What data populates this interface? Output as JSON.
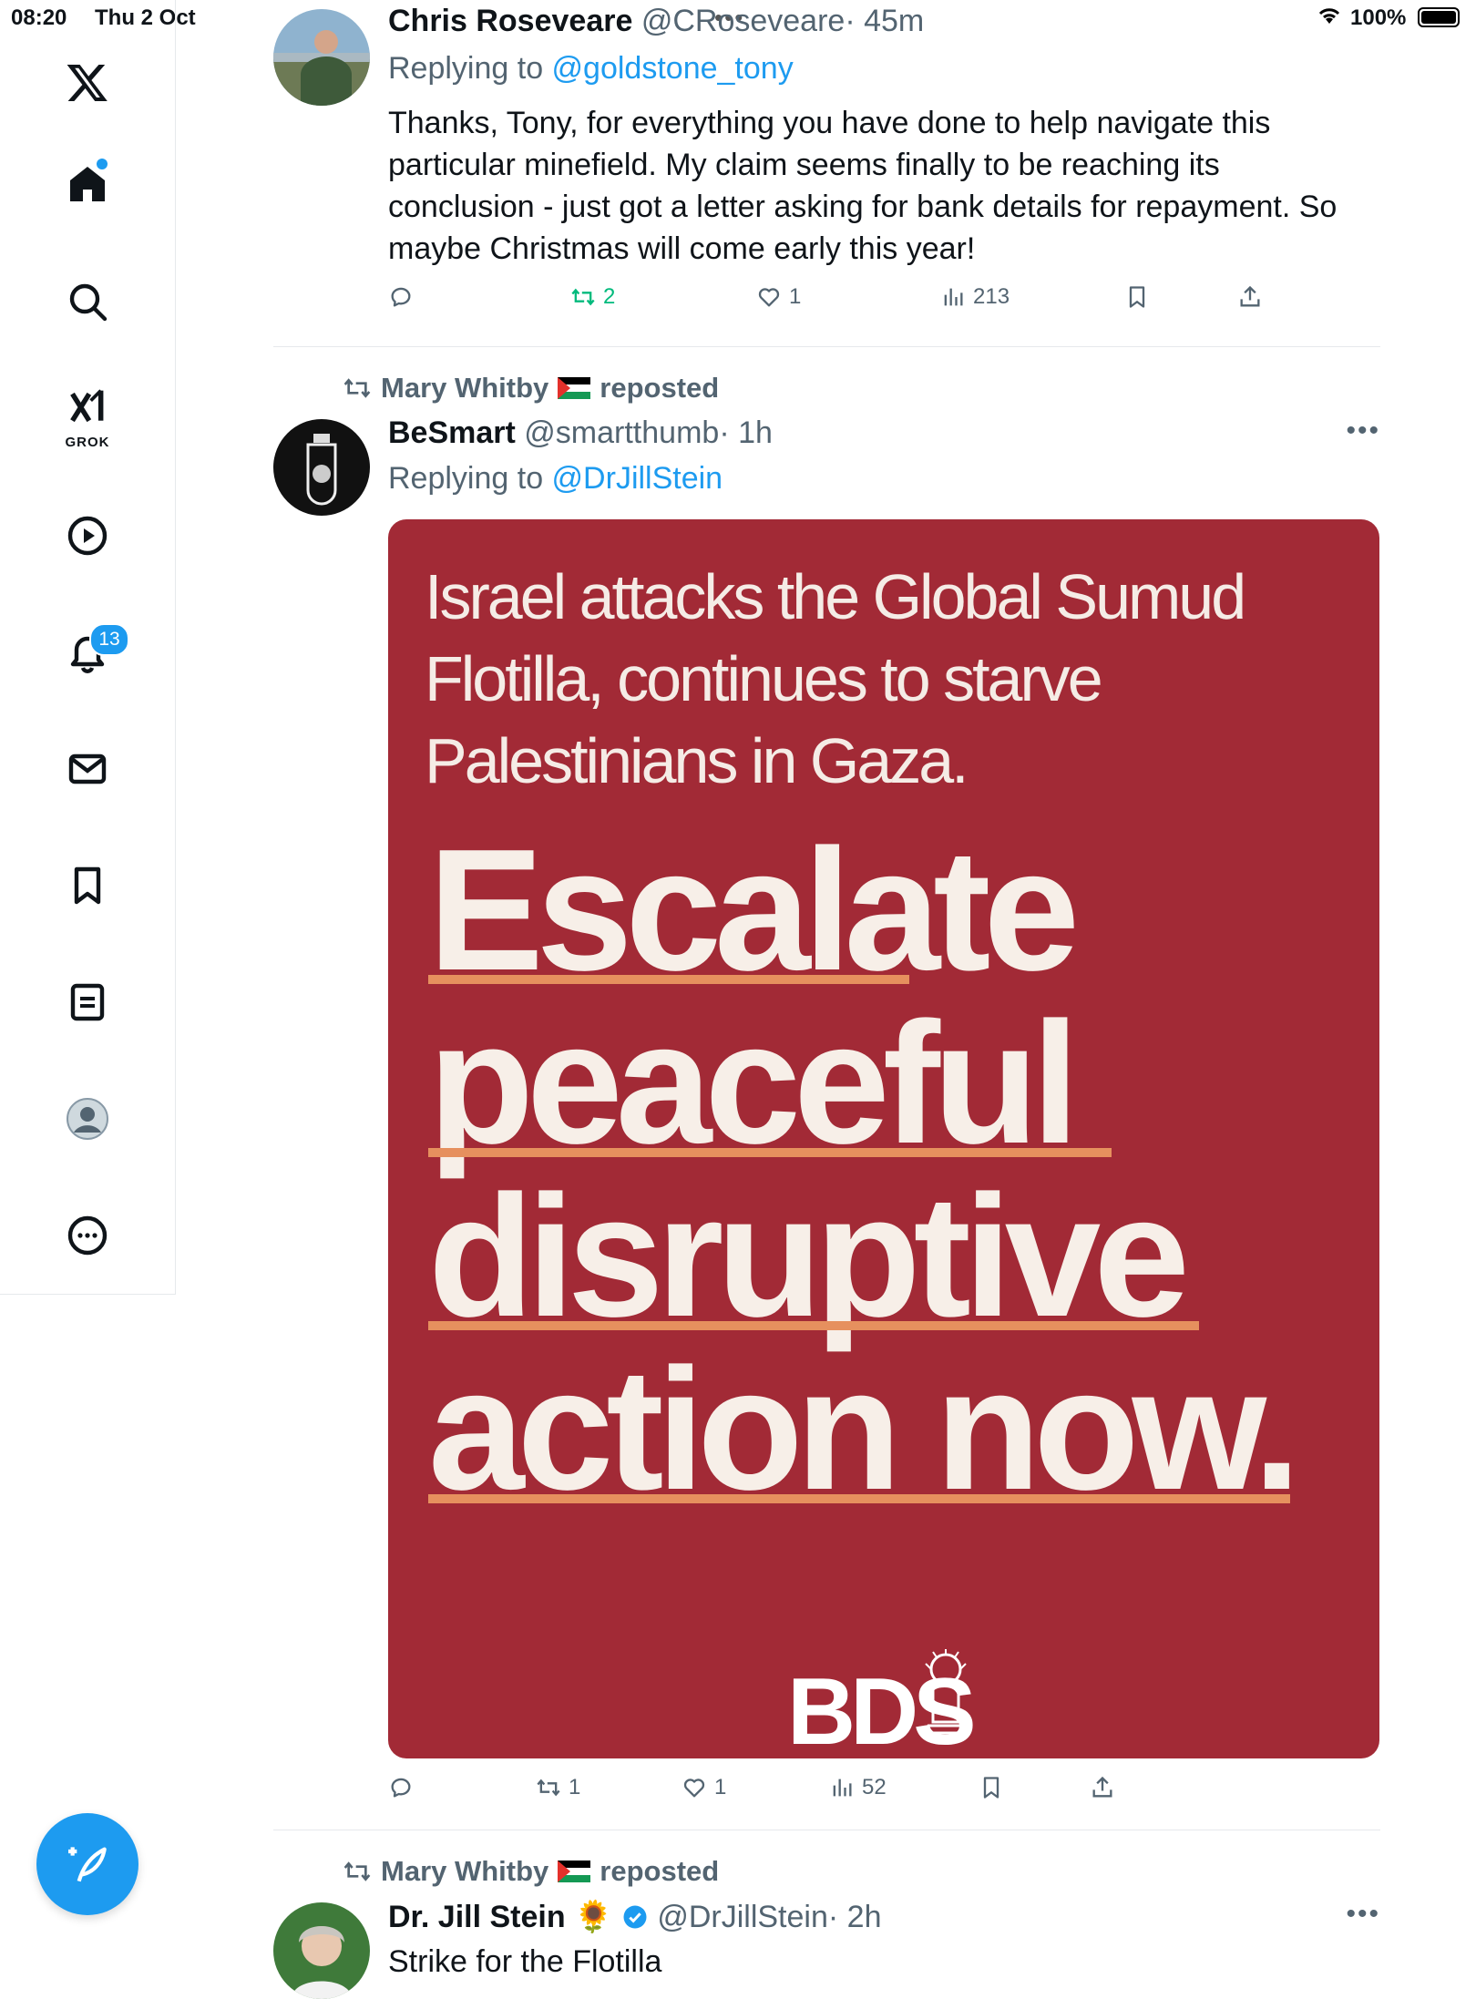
{
  "status_bar": {
    "time": "08:20",
    "date": "Thu 2 Oct",
    "battery": "100%"
  },
  "sidebar": {
    "grok_label": "GROK",
    "notifications_badge": "13"
  },
  "tweets": [
    {
      "name": "Chris Roseveare",
      "handle": "@CRoseveare",
      "time": "· 45m",
      "replying_prefix": "Replying to ",
      "replying_to": "@goldstone_tony",
      "text": "Thanks, Tony, for everything you have done to help navigate this particular minefield. My claim seems finally to be reaching its conclusion - just got a letter asking for bank details for repayment. So maybe Christmas will come early this year!",
      "retweets": "2",
      "likes": "1",
      "views": "213"
    },
    {
      "repost_by": "Mary Whitby",
      "repost_suffix": "reposted",
      "name": "BeSmart",
      "handle": "@smartthumb",
      "time": "· 1h",
      "replying_prefix": "Replying to ",
      "replying_to": "@DrJillStein",
      "poster": {
        "headline": "Israel attacks the Global Sumud Flotilla, continues to starve Palestinians in Gaza.",
        "line1": "Escalate",
        "line2": "peaceful",
        "line3": "disruptive",
        "line4": "action now.",
        "logo": "BDS"
      },
      "retweets": "1",
      "likes": "1",
      "views": "52"
    },
    {
      "repost_by": "Mary Whitby",
      "repost_suffix": "reposted",
      "name": "Dr. Jill Stein",
      "emoji": "🌻",
      "handle": "@DrJillStein",
      "time": "· 2h",
      "text": "Strike for the Flotilla"
    }
  ],
  "colors": {
    "accent": "#1d9bf0",
    "poster_bg": "#a22a36",
    "underline": "#e6905e",
    "retweet_green": "#00ba7c"
  }
}
